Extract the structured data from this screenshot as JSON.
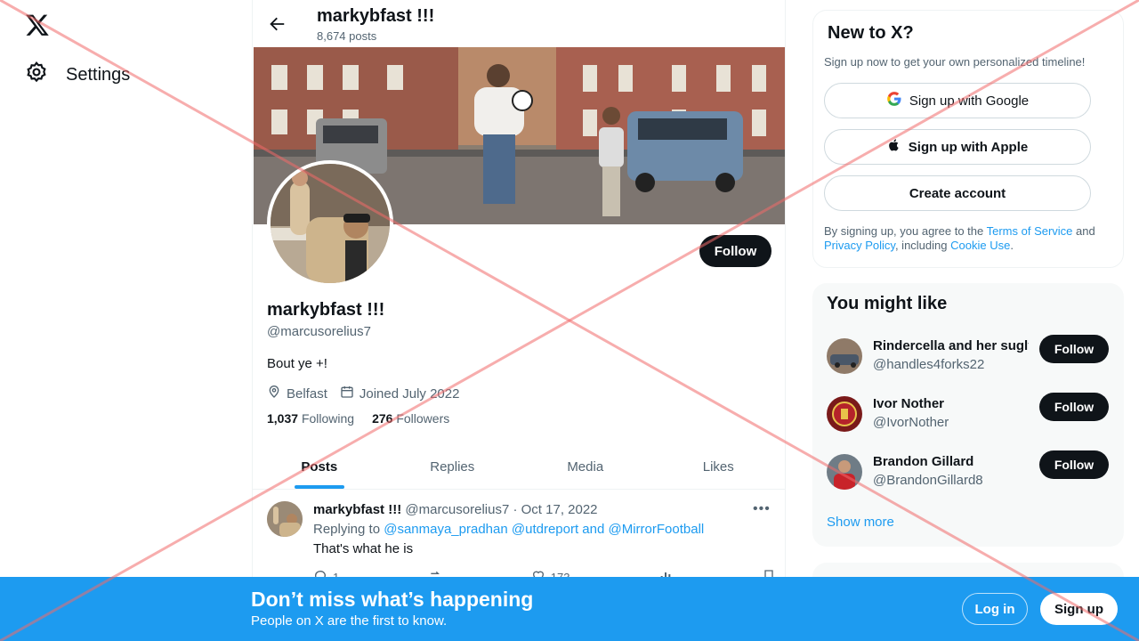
{
  "nav": {
    "settings_label": "Settings"
  },
  "header": {
    "name": "markybfast !!!",
    "post_count": "8,674 posts"
  },
  "profile": {
    "follow_label": "Follow",
    "name": "markybfast !!!",
    "handle": "@marcusorelius7",
    "bio": "Bout ye +!",
    "location": "Belfast",
    "joined": "Joined July 2022",
    "following_count": "1,037",
    "following_label": "Following",
    "followers_count": "276",
    "followers_label": "Followers"
  },
  "tabs": [
    "Posts",
    "Replies",
    "Media",
    "Likes"
  ],
  "post": {
    "name": "markybfast !!!",
    "handle_date": "@marcusorelius7 · Oct 17, 2022",
    "replying_label": "Replying to",
    "replying_to": "@sanmaya_pradhan @utdreport and @MirrorFootball",
    "text": "That's what he is",
    "replies": "1",
    "likes": "173"
  },
  "signup_card": {
    "title": "New to X?",
    "subtitle": "Sign up now to get your own personalized timeline!",
    "google_label": "Sign up with Google",
    "apple_label": "Sign up with Apple",
    "create_label": "Create account",
    "legal_prefix": "By signing up, you agree to the ",
    "terms": "Terms of Service",
    "and": " and ",
    "privacy": "Privacy Policy",
    "including": ", including ",
    "cookie": "Cookie Use",
    "period": "."
  },
  "suggestions": {
    "title": "You might like",
    "follow_label": "Follow",
    "items": [
      {
        "name": "Rindercella and her sugly sisters",
        "handle": "@handles4forks22"
      },
      {
        "name": "Ivor Nother",
        "handle": "@IvorNother"
      },
      {
        "name": "Brandon Gillard",
        "handle": "@BrandonGillard8"
      }
    ],
    "show_more": "Show more"
  },
  "bottom_bar": {
    "title": "Don’t miss what’s happening",
    "subtitle": "People on X are the first to know.",
    "login_label": "Log in",
    "signup_label": "Sign up"
  },
  "colors": {
    "accent": "#1d9bf0",
    "text": "#0f1419",
    "muted": "#536471"
  }
}
